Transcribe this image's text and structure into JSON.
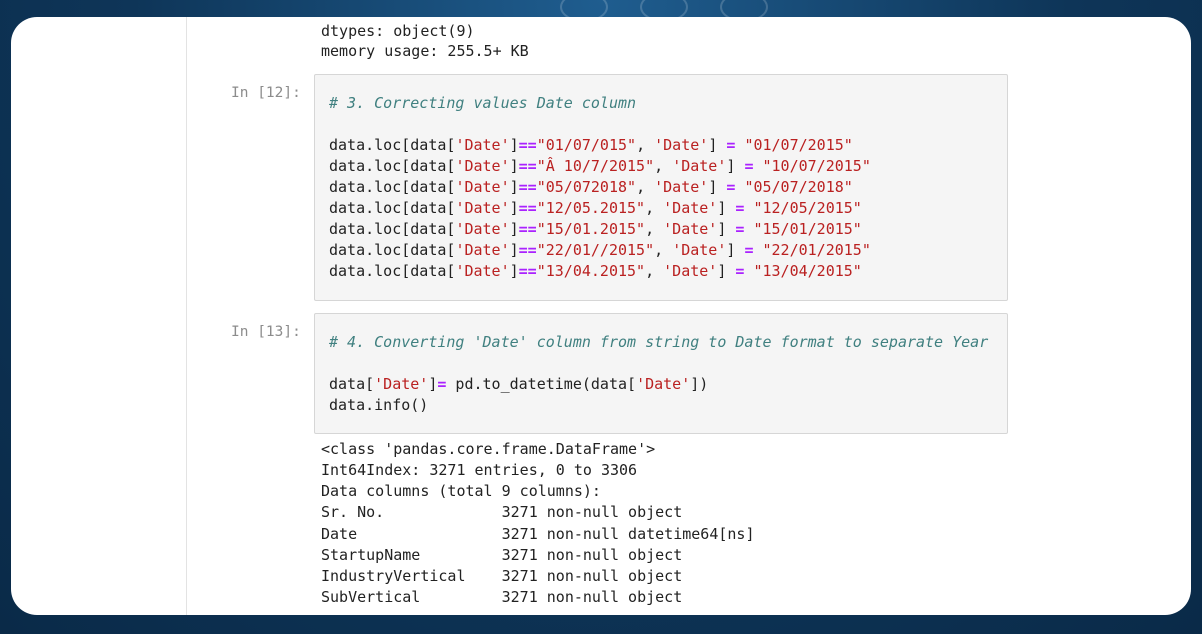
{
  "colors": {
    "frame_bg": "#0e3558",
    "card_bg": "#ffffff",
    "comment": "#408080",
    "string": "#ba2121",
    "operator": "#aa22ff",
    "prompt": "#8c8c8c"
  },
  "top_output": [
    "dtypes: object(9)",
    "memory usage: 255.5+ KB"
  ],
  "cell12": {
    "prompt": "In [12]:",
    "comment": "# 3. Correcting values Date column",
    "lines": [
      {
        "a": "data.loc[data[",
        "k": "'Date'",
        "b": "]",
        "eq": "==",
        "s1": "\"01/07/015\"",
        "c": ", ",
        "k2": "'Date'",
        "d": "] ",
        "as": "=",
        "e": " ",
        "s2": "\"01/07/2015\""
      },
      {
        "a": "data.loc[data[",
        "k": "'Date'",
        "b": "]",
        "eq": "==",
        "s1": "\"Â 10/7/2015\"",
        "c": ", ",
        "k2": "'Date'",
        "d": "] ",
        "as": "=",
        "e": " ",
        "s2": "\"10/07/2015\""
      },
      {
        "a": "data.loc[data[",
        "k": "'Date'",
        "b": "]",
        "eq": "==",
        "s1": "\"05/072018\"",
        "c": ", ",
        "k2": "'Date'",
        "d": "] ",
        "as": "=",
        "e": " ",
        "s2": "\"05/07/2018\""
      },
      {
        "a": "data.loc[data[",
        "k": "'Date'",
        "b": "]",
        "eq": "==",
        "s1": "\"12/05.2015\"",
        "c": ", ",
        "k2": "'Date'",
        "d": "] ",
        "as": "=",
        "e": " ",
        "s2": "\"12/05/2015\""
      },
      {
        "a": "data.loc[data[",
        "k": "'Date'",
        "b": "]",
        "eq": "==",
        "s1": "\"15/01.2015\"",
        "c": ", ",
        "k2": "'Date'",
        "d": "] ",
        "as": "=",
        "e": " ",
        "s2": "\"15/01/2015\""
      },
      {
        "a": "data.loc[data[",
        "k": "'Date'",
        "b": "]",
        "eq": "==",
        "s1": "\"22/01//2015\"",
        "c": ", ",
        "k2": "'Date'",
        "d": "] ",
        "as": "=",
        "e": " ",
        "s2": "\"22/01/2015\""
      },
      {
        "a": "data.loc[data[",
        "k": "'Date'",
        "b": "]",
        "eq": "==",
        "s1": "\"13/04.2015\"",
        "c": ", ",
        "k2": "'Date'",
        "d": "] ",
        "as": "=",
        "e": " ",
        "s2": "\"13/04/2015\""
      }
    ]
  },
  "cell13": {
    "prompt": "In [13]:",
    "comment": "# 4. Converting 'Date' column from string to Date format to separate Year",
    "line1": {
      "a": "data[",
      "k": "'Date'",
      "b": "]",
      "eq": "=",
      "c": " pd.to_datetime(data[",
      "k2": "'Date'",
      "d": "])"
    },
    "line2": "data.info()"
  },
  "bottom_output": [
    "<class 'pandas.core.frame.DataFrame'>",
    "Int64Index: 3271 entries, 0 to 3306",
    "Data columns (total 9 columns):",
    "Sr. No.             3271 non-null object",
    "Date                3271 non-null datetime64[ns]",
    "StartupName         3271 non-null object",
    "IndustryVertical    3271 non-null object",
    "SubVertical         3271 non-null object"
  ]
}
